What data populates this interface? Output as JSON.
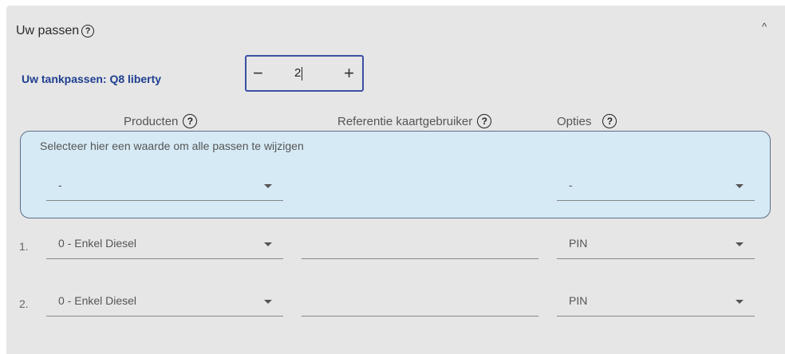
{
  "section": {
    "title": "Uw passen",
    "help_glyph": "?",
    "collapse_glyph": "^"
  },
  "tankpassen": {
    "label": "Uw tankpassen: Q8 liberty",
    "minus": "−",
    "plus": "+",
    "value": "2"
  },
  "columns": {
    "producten": "Producten",
    "referentie": "Referentie kaartgebruiker",
    "opties": "Opties"
  },
  "bulk": {
    "label": "Selecteer hier een waarde om alle passen te wijzigen",
    "product_value": "-",
    "option_value": "-"
  },
  "rows": [
    {
      "number": "1.",
      "product": "0 - Enkel Diesel",
      "reference": "",
      "option": "PIN"
    },
    {
      "number": "2.",
      "product": "0 - Enkel Diesel",
      "reference": "",
      "option": "PIN"
    }
  ]
}
